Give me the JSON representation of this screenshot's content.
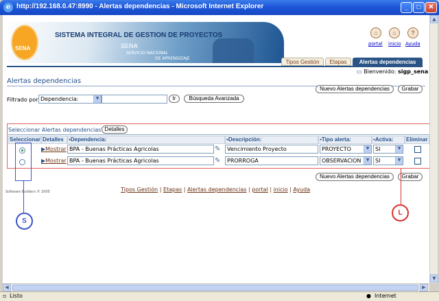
{
  "window": {
    "title": "http://192.168.0.47:8990 - Alertas dependencias - Microsoft Internet Explorer",
    "minimize": "_",
    "maximize": "□",
    "close": "✕"
  },
  "banner": {
    "title": "SISTEMA INTEGRAL DE GESTION DE PROYECTOS",
    "logo_text": "SENA",
    "sena": "SENA",
    "sub1": "SERVICIO NACIONAL",
    "sub2": "DE APRENDIZAJE"
  },
  "top_links": [
    {
      "label": "portal",
      "icon": "portal-icon",
      "glyph": "⌂"
    },
    {
      "label": "inicio",
      "icon": "home-icon",
      "glyph": "⌂"
    },
    {
      "label": "Ayuda",
      "icon": "help-icon",
      "glyph": "?"
    }
  ],
  "tabs": [
    "Tipos Gestión",
    "Etapas",
    "Alertas dependencias"
  ],
  "welcome": {
    "label": "Bienvenido:",
    "user": "sigp_sena"
  },
  "page_title": "Alertas dependencias",
  "buttons": {
    "new_alert": "Nuevo Alertas dependencias",
    "save": "Grabar",
    "go": "Ir",
    "advanced_search": "Búsqueda Avanzada",
    "details": "Detalles"
  },
  "filter": {
    "label": "Filtrado por",
    "selected": "Dependencia:",
    "value": ""
  },
  "section_header": "Seleccionar Alertas dependencias",
  "columns": [
    "Seleccionar",
    "Detalles",
    "Dependencia:",
    "Descripción:",
    "Tipo alerta:",
    "Activa:",
    "Eliminar"
  ],
  "rows": [
    {
      "selected": true,
      "details": "Mostrar",
      "dependencia": "BPA - Buenas Prácticas Agricolas",
      "descripcion": "Vencimiento Proyecto",
      "tipo": "PROYECTO",
      "activa": "SI"
    },
    {
      "selected": false,
      "details": "Mostrar",
      "dependencia": "BPA - Buenas Prácticas Agricolas",
      "descripcion": "PRORROGA",
      "tipo": "OBSERVACION",
      "activa": "SI"
    }
  ],
  "footer_links": [
    "Tipos Gestión",
    "Etapas",
    "Alertas dependencias",
    "portal",
    "inicio",
    "Ayuda"
  ],
  "software_note": "Software Builders © 2005",
  "annotations": {
    "s": "S",
    "l": "L"
  },
  "status": {
    "left": "Listo",
    "right": "Internet"
  }
}
